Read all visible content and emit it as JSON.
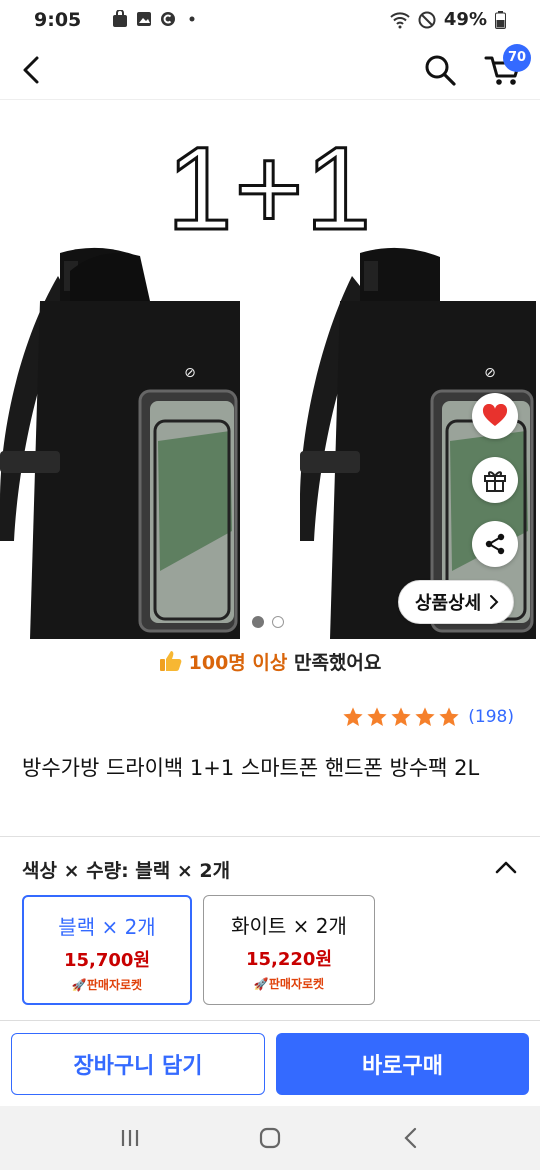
{
  "status_bar": {
    "time": "9:05",
    "battery": "49%",
    "left_icons": [
      "bag-icon",
      "image-icon",
      "c-circle-icon",
      "dot-icon"
    ],
    "right_icons": [
      "wifi-icon",
      "do-not-disturb-icon",
      "battery-icon"
    ]
  },
  "nav": {
    "cart_count": "70"
  },
  "hero": {
    "promo_text": "1+1",
    "image_count": 2,
    "active_index": 0,
    "detail_button": "상품상세",
    "fab_icons": [
      "heart-icon",
      "gift-icon",
      "share-icon"
    ]
  },
  "satisfaction": {
    "highlight": "100명 이상",
    "rest": " 만족했어요"
  },
  "rating": {
    "stars": 5,
    "count": "(198)"
  },
  "product": {
    "title": "방수가방 드라이백 1+1 스마트폰 핸드폰 방수팩 2L"
  },
  "options": {
    "header": "색상 × 수량: 블랙 × 2개",
    "items": [
      {
        "name": "블랙 × 2개",
        "price": "15,700원",
        "badge": "판매자로켓",
        "selected": true
      },
      {
        "name": "화이트 × 2개",
        "price": "15,220원",
        "badge": "판매자로켓",
        "selected": false
      }
    ]
  },
  "actions": {
    "add_to_cart": "장바구니 담기",
    "buy_now": "바로구매"
  },
  "colors": {
    "accent": "#346aff",
    "price": "#c80000",
    "highlight": "#d9650b",
    "star": "#f5802b"
  }
}
